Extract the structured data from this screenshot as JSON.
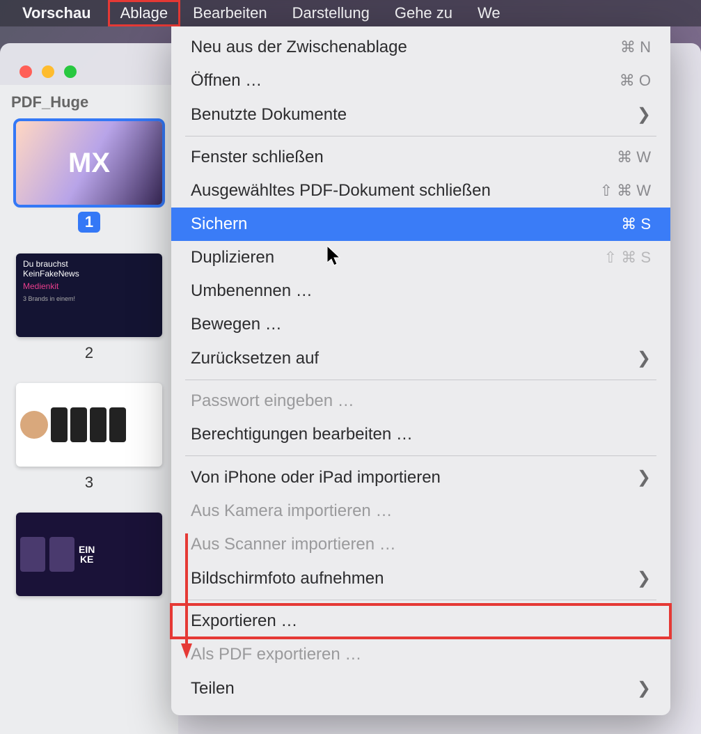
{
  "menubar": {
    "app": "Vorschau",
    "items": [
      "Ablage",
      "Bearbeiten",
      "Darstellung",
      "Gehe zu",
      "We"
    ]
  },
  "sidebar": {
    "title": "PDF_Huge",
    "pages": [
      "1",
      "2",
      "3"
    ],
    "thumb1_text": "MX",
    "thumb2_line1": "Du brauchst",
    "thumb2_line2": "KeinFakeNews",
    "thumb2_line3": "Medienkit",
    "thumb2_line4": "3 Brands in einem!",
    "thumb4_logo1": "EIN",
    "thumb4_logo2": "KE"
  },
  "menu": [
    {
      "label": "Neu aus der Zwischenablage",
      "shortcut": "⌘ N",
      "type": "item"
    },
    {
      "label": "Öffnen …",
      "shortcut": "⌘ O",
      "type": "item"
    },
    {
      "label": "Benutzte Dokumente",
      "type": "submenu"
    },
    {
      "type": "sep"
    },
    {
      "label": "Fenster schließen",
      "shortcut": "⌘ W",
      "type": "item"
    },
    {
      "label": "Ausgewähltes PDF-Dokument schließen",
      "shortcut": "⇧ ⌘ W",
      "type": "item"
    },
    {
      "label": "Sichern",
      "shortcut": "⌘ S",
      "type": "item",
      "highlight": true
    },
    {
      "label": "Duplizieren",
      "shortcut": "⇧ ⌘ S",
      "type": "item",
      "shortcut_dim": true
    },
    {
      "label": "Umbenennen …",
      "type": "item"
    },
    {
      "label": "Bewegen …",
      "type": "item"
    },
    {
      "label": "Zurücksetzen auf",
      "type": "submenu"
    },
    {
      "type": "sep"
    },
    {
      "label": "Passwort eingeben …",
      "type": "item",
      "disabled": true
    },
    {
      "label": "Berechtigungen bearbeiten …",
      "type": "item"
    },
    {
      "type": "sep"
    },
    {
      "label": "Von iPhone oder iPad importieren",
      "type": "submenu"
    },
    {
      "label": "Aus Kamera importieren …",
      "type": "item",
      "disabled": true
    },
    {
      "label": "Aus Scanner importieren …",
      "type": "item",
      "disabled": true
    },
    {
      "label": "Bildschirmfoto aufnehmen",
      "type": "submenu"
    },
    {
      "type": "sep"
    },
    {
      "label": "Exportieren …",
      "type": "item",
      "redbox": true
    },
    {
      "label": "Als PDF exportieren …",
      "type": "item",
      "disabled": true
    },
    {
      "label": "Teilen",
      "type": "submenu"
    }
  ]
}
